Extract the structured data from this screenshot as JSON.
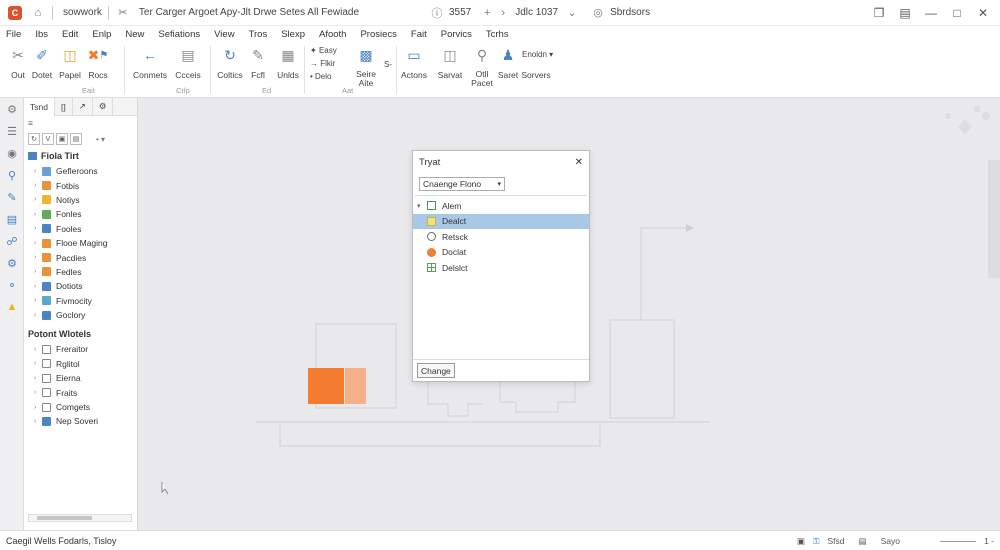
{
  "titlebar": {
    "app_badge": "C",
    "doc_name": "sowwork",
    "title": "Ter Carger Argoet  Apy-Jlt Drwe Setes  All Fewiade",
    "info1": "3557",
    "info2": "Jdlc 1037",
    "info3": "Sbrdsors"
  },
  "menu": [
    "File",
    "Ibs",
    "Edit",
    "Enlp",
    "New",
    "Sefiations",
    "View",
    "Tros",
    "Slexp",
    "Afooth",
    "Prosiecs",
    "Fait",
    "Porvics",
    "Tcrhs"
  ],
  "ribbon": {
    "buttons": [
      {
        "label": "Out",
        "icon": "cut-icon"
      },
      {
        "label": "Dotet",
        "icon": "lasso-icon"
      },
      {
        "label": "Papel",
        "icon": "paste-icon"
      },
      {
        "label": "Rocs",
        "icon": "flag-icon"
      },
      {
        "label": "Conmets",
        "icon": "back-arrow-icon"
      },
      {
        "label": "Ccceis",
        "icon": "list-icon"
      },
      {
        "label": "Coltics",
        "icon": "rotate-icon"
      },
      {
        "label": "Fcfl",
        "icon": "pen-icon"
      },
      {
        "label": "Unlds",
        "icon": "grid-icon"
      },
      {
        "label": "Seire Aite",
        "icon": "image-icon"
      },
      {
        "label": "Actons",
        "icon": "window-icon"
      },
      {
        "label": "Sarvat",
        "icon": "doc-icon"
      },
      {
        "label": "Otll Pacet",
        "icon": "search-icon"
      },
      {
        "label": "Saret",
        "icon": "person-icon"
      },
      {
        "label": "Sorvers",
        "icon": "enable-icon"
      }
    ],
    "small": {
      "a": "Easy",
      "b": "Flkir",
      "c": "Delo",
      "s": "S-",
      "enable": "Enoldn"
    },
    "groups": [
      "Eait",
      "Crlp",
      "Ed",
      "Aat"
    ]
  },
  "left_strip_icons": [
    "tool-icon",
    "settings-icon",
    "node-icon",
    "search-icon",
    "pen-icon",
    "folder-icon",
    "link-icon",
    "gear-icon",
    "attach-icon",
    "warning-icon"
  ],
  "panel": {
    "tabs": [
      "Tsnd",
      "[]",
      "↗",
      "⚙"
    ],
    "filter": "≡",
    "tools": [
      "↻",
      "V",
      "▣",
      "▤"
    ],
    "sections": [
      {
        "label": "Fiola Tirt",
        "items": [
          {
            "label": "Gefleroons",
            "color": "#6aa0d6"
          },
          {
            "label": "Fotbis",
            "color": "#e8923a"
          },
          {
            "label": "Notiys",
            "color": "#f0b530"
          },
          {
            "label": "Fonles",
            "color": "#5fae57"
          },
          {
            "label": "Fooles",
            "color": "#4c83c3"
          },
          {
            "label": "Flooe Maging",
            "color": "#e8923a"
          },
          {
            "label": "Pacdies",
            "color": "#e8923a"
          },
          {
            "label": "Fedles",
            "color": "#e8923a"
          },
          {
            "label": "Dotiots",
            "color": "#4c83c3"
          },
          {
            "label": "Fivmocity",
            "color": "#5aa9c8"
          },
          {
            "label": "Goclory",
            "color": "#4c83c3"
          }
        ]
      },
      {
        "label": "Potont Wlotels",
        "items": [
          {
            "label": "Freraitor",
            "color": "#888"
          },
          {
            "label": "Rglitol",
            "color": "#888"
          },
          {
            "label": "Eierna",
            "color": "#888"
          },
          {
            "label": "Fraits",
            "color": "#888"
          },
          {
            "label": "Comgets",
            "color": "#888"
          },
          {
            "label": "Nep Soveri",
            "color": "#4c83c3"
          }
        ]
      }
    ]
  },
  "dialog": {
    "title": "Tryat",
    "select_value": "Cnaenge Flono",
    "items": [
      {
        "label": "Alem",
        "icon": "square-outline-icon",
        "selected": false
      },
      {
        "label": "Dealct",
        "icon": "yellow-square-icon",
        "selected": true
      },
      {
        "label": "Retsck",
        "icon": "circle-outline-icon",
        "selected": false
      },
      {
        "label": "Doclat",
        "icon": "orange-circle-icon",
        "selected": false
      },
      {
        "label": "Delslct",
        "icon": "grid-square-icon",
        "selected": false
      }
    ],
    "button": "Change"
  },
  "status": {
    "text": "Caegil Wells Fodarls, Tisloy",
    "right1": "Sfsd",
    "right2": "Sayo",
    "right3": "1 -"
  },
  "colors": {
    "accent": "#4c83c3",
    "orange": "#f47c2f",
    "orange_light": "#f5b08a",
    "selection": "#a9c8e8"
  }
}
